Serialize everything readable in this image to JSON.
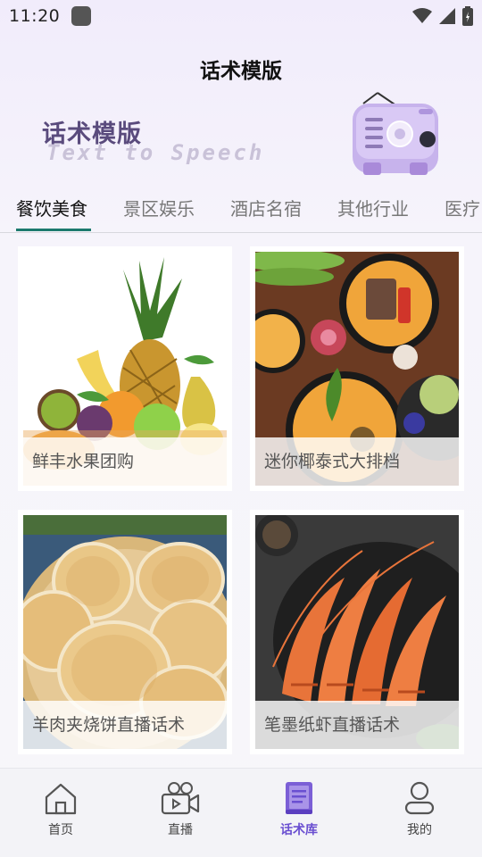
{
  "status_bar": {
    "time": "11:20"
  },
  "header": {
    "title": "话术模版"
  },
  "banner": {
    "title": "话术模版",
    "subtitle": "Text to Speech"
  },
  "tabs": [
    {
      "label": "餐饮美食",
      "active": true
    },
    {
      "label": "景区娱乐",
      "active": false
    },
    {
      "label": "酒店名宿",
      "active": false
    },
    {
      "label": "其他行业",
      "active": false
    },
    {
      "label": "医疗",
      "active": false
    }
  ],
  "cards": [
    {
      "title": "鲜丰水果团购",
      "image": "fruit-basket"
    },
    {
      "title": "迷你椰泰式大排档",
      "image": "thai-curry"
    },
    {
      "title": "羊肉夹烧饼直播话术",
      "image": "sesame-flatbread"
    },
    {
      "title": "笔墨纸虾直播话术",
      "image": "grilled-prawns"
    }
  ],
  "bottom_nav": [
    {
      "label": "首页",
      "icon": "home-icon",
      "active": false
    },
    {
      "label": "直播",
      "icon": "video-camera-icon",
      "active": false
    },
    {
      "label": "话术库",
      "icon": "book-icon",
      "active": true
    },
    {
      "label": "我的",
      "icon": "user-icon",
      "active": false
    }
  ],
  "colors": {
    "accent": "#6a4fd1",
    "tab_indicator": "#1c7a6e",
    "banner_title": "#5a4b7d"
  }
}
